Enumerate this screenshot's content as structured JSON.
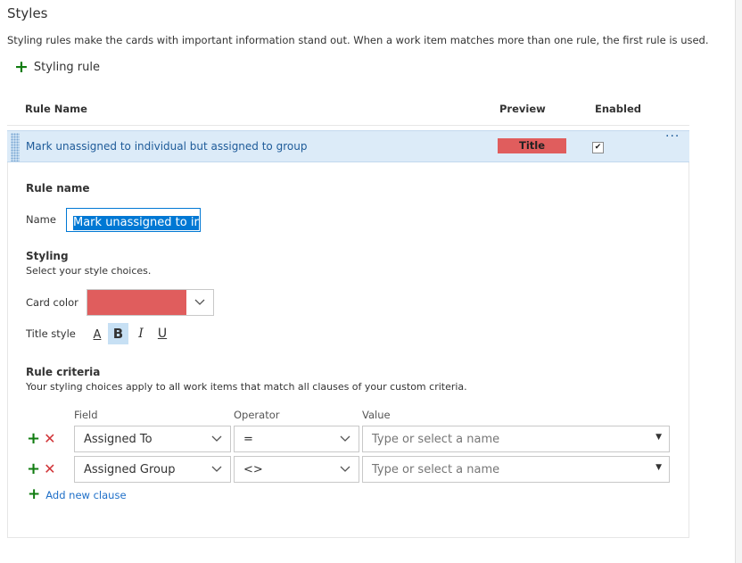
{
  "section": {
    "title": "Styles",
    "description": "Styling rules make the cards with important information stand out. When a work item matches more than one rule, the first rule is used.",
    "add_rule_label": "Styling rule"
  },
  "table": {
    "headers": {
      "rule_name": "Rule Name",
      "preview": "Preview",
      "enabled": "Enabled"
    },
    "rule": {
      "name": "Mark unassigned to individual but assigned to group",
      "preview_label": "Title",
      "enabled_mark": "✔",
      "more_icon": "···"
    }
  },
  "editor": {
    "rule_name_heading": "Rule name",
    "name_label": "Name",
    "name_value": "Mark unassigned to ir",
    "styling_heading": "Styling",
    "styling_desc": "Select your style choices.",
    "card_color_label": "Card color",
    "card_color": "#e05d5d",
    "title_style_label": "Title style",
    "style_buttons": {
      "font_color": "A",
      "bold": "B",
      "italic": "I",
      "underline": "U"
    },
    "criteria_heading": "Rule criteria",
    "criteria_desc": "Your styling choices apply to all work items that match all clauses of your custom criteria.",
    "columns": {
      "field": "Field",
      "operator": "Operator",
      "value": "Value"
    },
    "clauses": [
      {
        "field": "Assigned To",
        "operator": "=",
        "value_placeholder": "Type or select a name"
      },
      {
        "field": "Assigned Group",
        "operator": "<>",
        "value_placeholder": "Type or select a name"
      }
    ],
    "add_clause_label": "Add new clause"
  },
  "colors": {
    "accent": "#0078d4",
    "add_green": "#107c10",
    "remove_red": "#d13438",
    "selected_row": "#dcebf8"
  }
}
